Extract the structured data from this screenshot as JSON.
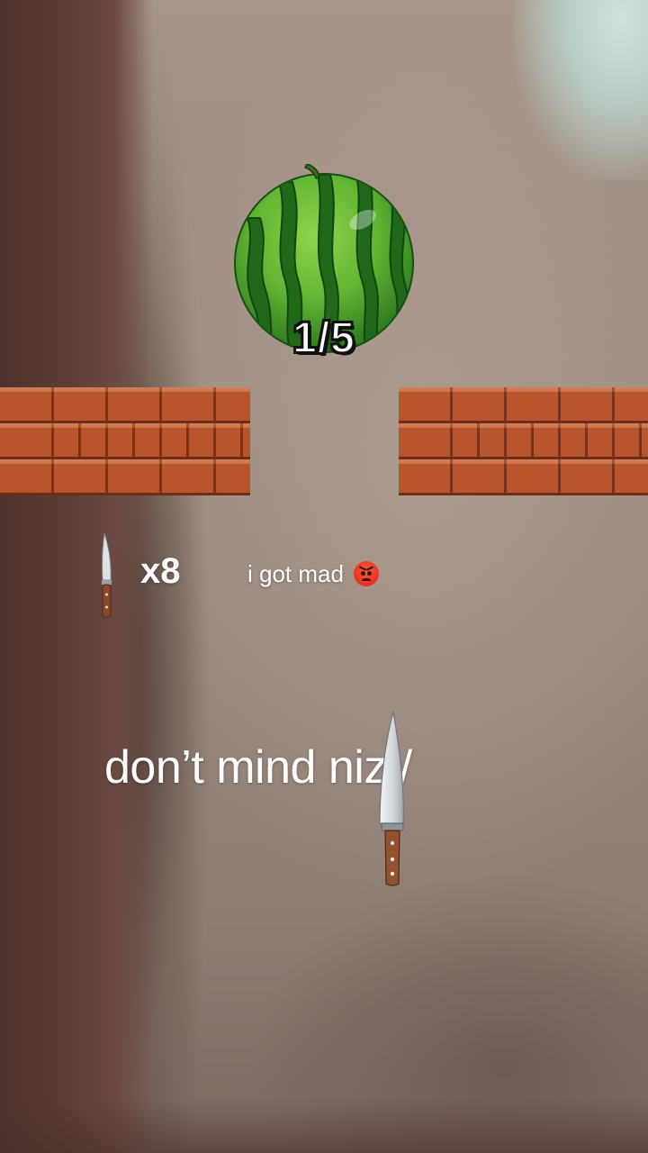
{
  "game": {
    "progress_label": "1/5",
    "knives_remaining": "x8"
  },
  "overlay": {
    "caption_small": "i got mad",
    "caption_big": "don’t mind niz:/"
  },
  "icons": {
    "target": "watermelon-icon",
    "knife": "knife-icon",
    "emoji": "angry-face-icon"
  },
  "colors": {
    "brick": "#b9552d",
    "melon_dark": "#1f6b1c",
    "melon_light": "#6fc23a"
  }
}
